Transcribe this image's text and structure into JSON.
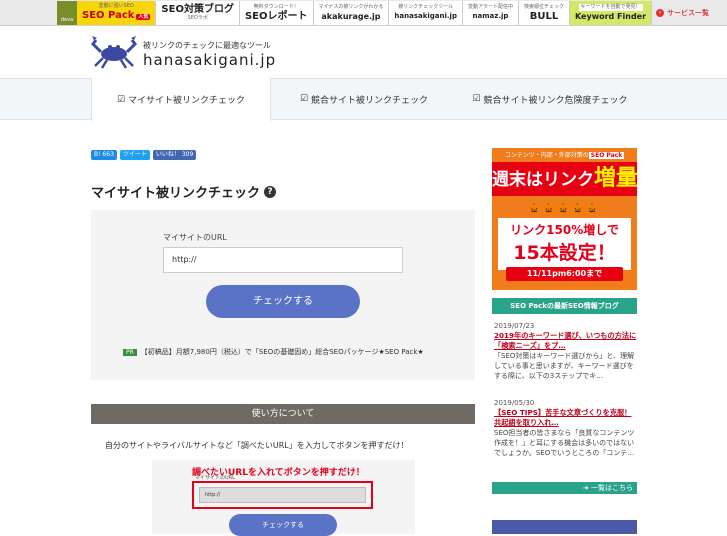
{
  "topbar": {
    "logo_text": "deva",
    "items": [
      {
        "small": "変動に強いSEO",
        "big": "SEO Pack",
        "badge": "人気",
        "style": "hl"
      },
      {
        "small": "SEOラボ",
        "big": "SEO対策ブログ",
        "style": ""
      },
      {
        "small": "無料ダウンロード！",
        "big": "SEOレポート",
        "style": ""
      },
      {
        "small": "マイナスの被リンクがわかる",
        "big": "akakurage.jp",
        "style": ""
      },
      {
        "small": "被リンクチェックツール",
        "big": "hanasakigani.jp",
        "style": ""
      },
      {
        "small": "変動アラート配信中",
        "big": "namaz.jp",
        "style": ""
      },
      {
        "small": "検索順位チェック",
        "big": "BULL",
        "style": ""
      },
      {
        "small": "キーワードを自動で発見！",
        "big": "Keyword Finder",
        "style": "kf"
      }
    ],
    "more_label": "サービス一覧"
  },
  "header": {
    "tagline": "被リンクのチェックに最適なツール",
    "site_name": "hanasakigani.jp"
  },
  "tabs": [
    {
      "label": "マイサイト被リンクチェック",
      "active": true
    },
    {
      "label": "競合サイト被リンクチェック",
      "active": false
    },
    {
      "label": "競合サイト被リンク危険度チェック",
      "active": false
    }
  ],
  "social": {
    "hatena": "B! 663",
    "tweet": "ツイート",
    "like": "いいね！ 309"
  },
  "page_title": "マイサイト被リンクチェック",
  "form": {
    "url_label": "マイサイトのURL",
    "url_value": "http://",
    "submit_label": "チェックする",
    "pr_tag": "PR",
    "pr_text": "【初稿品】月額7,980円（税込）で「SEOの基礎固め」総合SEOパッケージ★SEO Pack★"
  },
  "howto": {
    "heading": "使い方について",
    "description": "自分のサイトやライバルサイトなど「調べたいURL」を入力してボタンを押すだけ！",
    "image_caption": "調べたいURLを入れてボタンを押すだけ！",
    "image_label": "マイサイトのURL",
    "image_input": "http://",
    "image_button": "チェックする"
  },
  "banner": {
    "line1_prefix": "コンテンツ・内部・外部対策の",
    "line1_badge": "SEO Pack",
    "line2_prefix": "週末はリンク",
    "line2_big": "増量",
    "decor": "🎃🎃🎃🎃🎃",
    "line3": "リンク150%増しで",
    "line4": "15本設定！",
    "line5": "11/11pm6:00まで"
  },
  "blog": {
    "heading": "SEO Packの最新SEO情報ブログ",
    "posts": [
      {
        "date": "2019/07/23",
        "title": "2019年のキーワード選び、いつもの方法に「検索ニーズ」をプ…",
        "excerpt": "「SEO対策はキーワード選びから」と、理解している事と思いますが、キーワード選びをする際に、以下の3ステップでキ…"
      },
      {
        "date": "2019/05/30",
        "title": "【SEO TIPS】苦手な文章づくりを克服！共起語を取り入れ…",
        "excerpt": "SEO担当者の皆さまなら「良質なコンテンツ作成を！」と耳にする機会は多いのではないでしょうか。SEOでいうところの「コンテ…"
      }
    ],
    "more_label": "一覧はこちら"
  }
}
